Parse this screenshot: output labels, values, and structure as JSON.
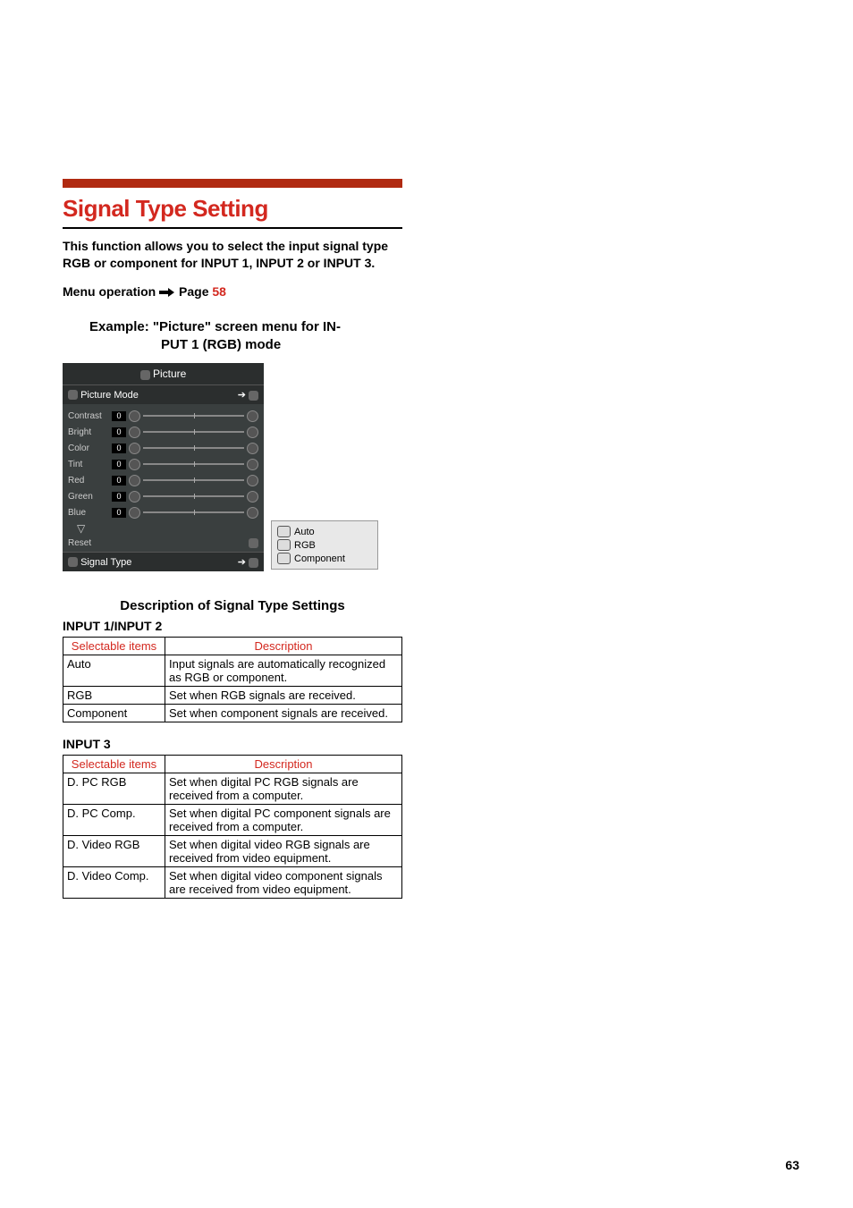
{
  "page_number": "63",
  "section_title": "Signal Type Setting",
  "intro": "This function allows you to select the input signal type RGB or component for INPUT 1, INPUT 2 or INPUT 3.",
  "menu_op_prefix": "Menu operation",
  "menu_op_page_label": "Page",
  "menu_op_page_num": "58",
  "example_line1": "Example: \"Picture\" screen menu for IN-",
  "example_line2": "PUT 1 (RGB) mode",
  "osd": {
    "title": "Picture",
    "picture_mode": "Picture Mode",
    "items": [
      {
        "label": "Contrast",
        "val": "0"
      },
      {
        "label": "Bright",
        "val": "0"
      },
      {
        "label": "Color",
        "val": "0"
      },
      {
        "label": "Tint",
        "val": "0"
      },
      {
        "label": "Red",
        "val": "0"
      },
      {
        "label": "Green",
        "val": "0"
      },
      {
        "label": "Blue",
        "val": "0"
      }
    ],
    "down": "▽",
    "reset": "Reset",
    "signal_type": "Signal Type"
  },
  "popup": {
    "opt1": "Auto",
    "opt2": "RGB",
    "opt3": "Component"
  },
  "desc_heading": "Description of Signal Type Settings",
  "input12_label": "INPUT 1/INPUT 2",
  "table_header_items": "Selectable items",
  "table_header_desc": "Description",
  "table12": [
    {
      "item": "Auto",
      "desc": "Input signals are automatically recognized as RGB or component."
    },
    {
      "item": "RGB",
      "desc": "Set when RGB signals are received."
    },
    {
      "item": "Component",
      "desc": "Set when component signals are received."
    }
  ],
  "input3_label": "INPUT 3",
  "table3": [
    {
      "item": "D. PC RGB",
      "desc": "Set when digital PC RGB signals are received from a computer."
    },
    {
      "item": "D. PC Comp.",
      "desc": "Set when digital PC component signals are received from a computer."
    },
    {
      "item": "D. Video RGB",
      "desc": "Set when digital video RGB signals are received from video equipment."
    },
    {
      "item": "D. Video Comp.",
      "desc": "Set when digital video component signals are received from video equipment."
    }
  ]
}
